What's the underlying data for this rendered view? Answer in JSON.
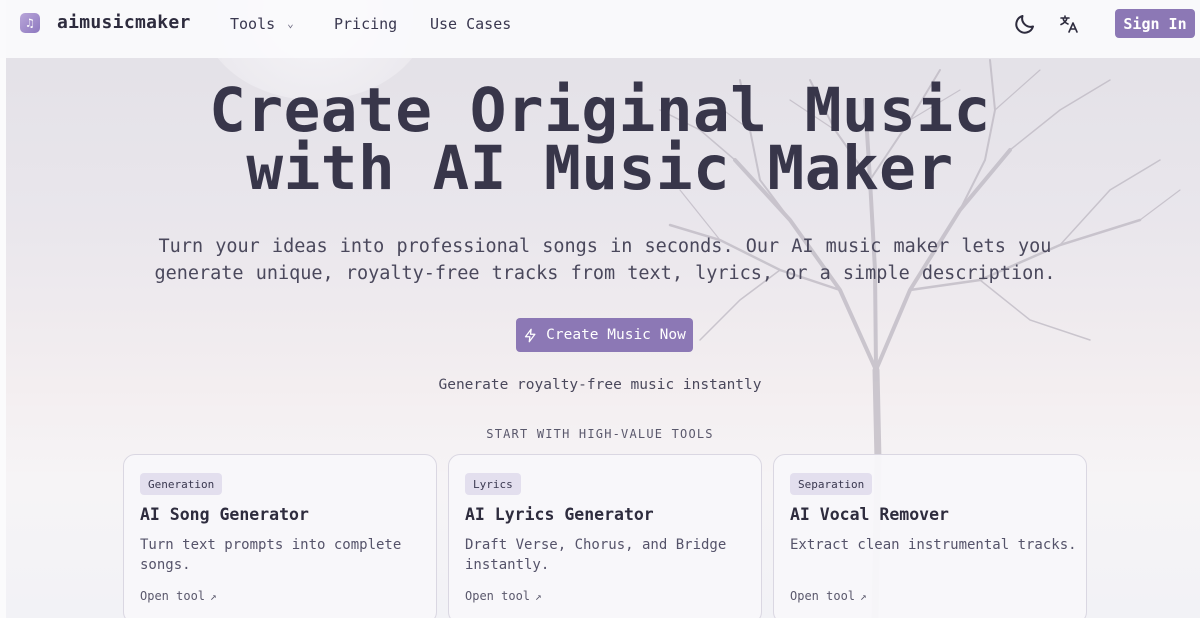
{
  "nav": {
    "brand": "aimusicmaker",
    "links": {
      "tools": "Tools",
      "pricing": "Pricing",
      "use_cases": "Use Cases"
    },
    "sign_in": "Sign In"
  },
  "hero": {
    "title_line1": "Create Original Music",
    "title_line2": "with AI Music Maker",
    "subtitle_line1": "Turn your ideas into professional songs in seconds. Our AI music maker lets you",
    "subtitle_line2": "generate unique, royalty-free tracks from text, lyrics, or a simple description.",
    "cta": "Create Music Now",
    "tagline": "Generate royalty-free music instantly"
  },
  "tools_section": {
    "label": "START WITH HIGH-VALUE TOOLS",
    "cards": [
      {
        "badge": "Generation",
        "title": "AI Song Generator",
        "description": "Turn text prompts into complete songs.",
        "link": "Open tool"
      },
      {
        "badge": "Lyrics",
        "title": "AI Lyrics Generator",
        "description": "Draft Verse, Chorus, and Bridge instantly.",
        "link": "Open tool"
      },
      {
        "badge": "Separation",
        "title": "AI Vocal Remover",
        "description": "Extract clean instrumental tracks.",
        "link": "Open tool"
      }
    ]
  },
  "colors": {
    "accent": "#8c78b5",
    "text": "#38364a",
    "badge_bg": "#e3dfee"
  },
  "icons": [
    "music-logo-icon",
    "chevron-down-icon",
    "moon-icon",
    "translate-icon",
    "lightning-icon",
    "arrow-up-right-icon"
  ]
}
